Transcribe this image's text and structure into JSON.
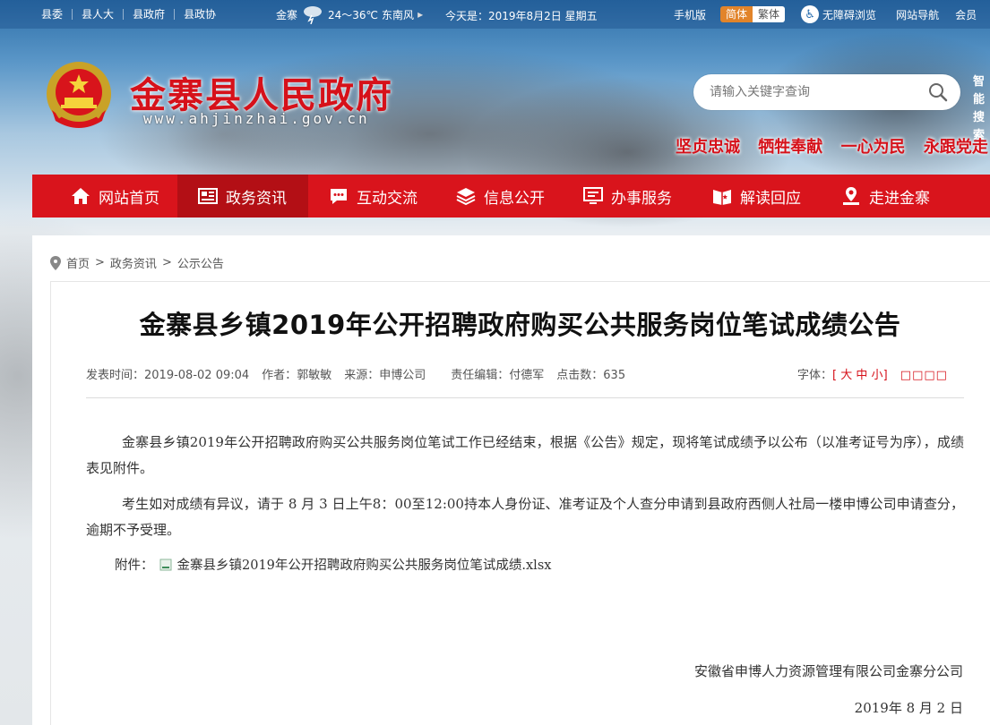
{
  "topbar": {
    "links": [
      "县委",
      "县人大",
      "县政府",
      "县政协"
    ],
    "weather_city": "金寨",
    "weather_temp": "24～36℃",
    "weather_wind": "东南风",
    "today": "今天是：2019年8月2日 星期五",
    "mobile": "手机版",
    "lang_simplified": "简体",
    "lang_traditional": "繁体",
    "accessibility": "无障碍浏览",
    "site_nav": "网站导航",
    "more": "会员"
  },
  "header": {
    "title": "金寨县人民政府",
    "url": "www.ahjinzhai.gov.cn",
    "search_placeholder": "请输入关键字查询",
    "smart_search": "智能搜索",
    "slogans": [
      "坚贞忠诚",
      "牺牲奉献",
      "一心为民",
      "永跟党走"
    ]
  },
  "nav": [
    {
      "label": "网站首页",
      "icon": "home-icon"
    },
    {
      "label": "政务资讯",
      "icon": "news-icon"
    },
    {
      "label": "互动交流",
      "icon": "chat-icon"
    },
    {
      "label": "信息公开",
      "icon": "layers-icon"
    },
    {
      "label": "办事服务",
      "icon": "monitor-icon"
    },
    {
      "label": "解读回应",
      "icon": "book-icon"
    },
    {
      "label": "走进金寨",
      "icon": "location-icon"
    }
  ],
  "breadcrumb": [
    "首页",
    "政务资讯",
    "公示公告"
  ],
  "article": {
    "title": "金寨县乡镇2019年公开招聘政府购买公共服务岗位笔试成绩公告",
    "publish_label": "发表时间：",
    "publish_time": "2019-08-02 09:04",
    "author_label": "作者：",
    "author": "郭敏敏",
    "source_label": "来源：",
    "source": "申博公司",
    "editor_label": "责任编辑：",
    "editor": "付德军",
    "clicks_label": "点击数：",
    "clicks": "635",
    "font_label": "字体：",
    "font_large": "大",
    "font_medium": "中",
    "font_small": "小",
    "font_boxes": "□□□□",
    "paragraph1": "金寨县乡镇2019年公开招聘政府购买公共服务岗位笔试工作已经结束，根据《公告》规定，现将笔试成绩予以公布（以准考证号为序），成绩表见附件。",
    "paragraph2": "考生如对成绩有异议，请于 8 月 3 日上午8：00至12:00持本人身份证、准考证及个人查分申请到县政府西侧人社局一楼申博公司申请查分，逾期不予受理。",
    "attachment_label": "附件：",
    "attachment_name": "金寨县乡镇2019年公开招聘政府购买公共服务岗位笔试成绩.xlsx",
    "signature": "安徽省申博人力资源管理有限公司金寨分公司",
    "date": "2019年 8 月 2 日"
  },
  "colors": {
    "brand_red": "#d9141c",
    "nav_active": "#b30f15",
    "lang_active": "#e2842a"
  }
}
